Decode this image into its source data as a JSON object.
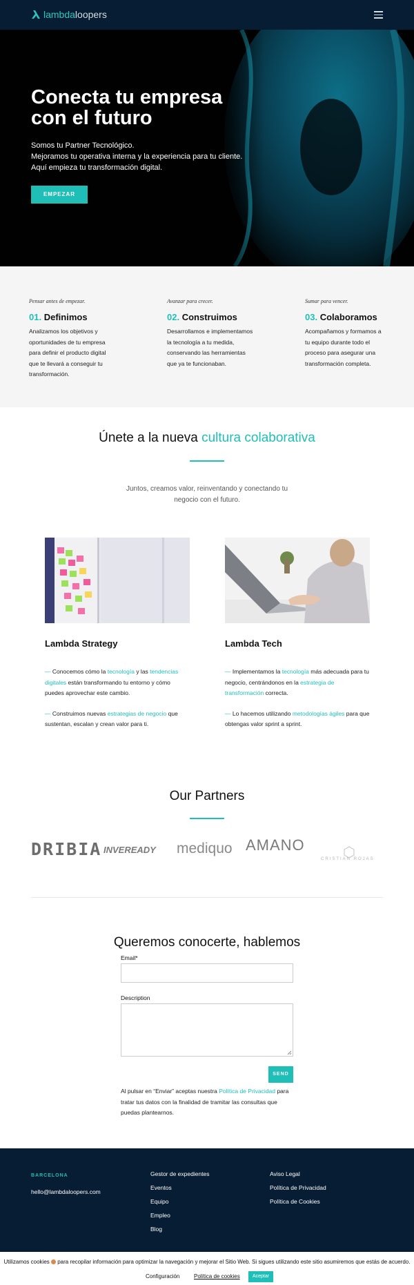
{
  "header": {
    "logo_bold": "lambda",
    "logo_rest": "loopers"
  },
  "hero": {
    "title_line1": "Conecta tu empresa",
    "title_line2": "con el futuro",
    "sub_line1": "Somos tu Partner Tecnológico.",
    "sub_line2": "Mejoramos tu operativa interna y la experiencia para tu cliente.",
    "sub_line3": "Aquí empieza tu transformación digital.",
    "cta": "EMPEZAR"
  },
  "steps": [
    {
      "kicker": "Pensar antes de empezar.",
      "num": "01.",
      "title": "Definimos",
      "text": "Analizamos los objetivos y oportunidades de tu empresa para definir el producto digital que te llevará a conseguir tu transformación."
    },
    {
      "kicker": "Avanzar para crecer.",
      "num": "02.",
      "title": "Construimos",
      "text": "Desarrollamos e implementamos la tecnología a tu medida, conservando las herramientas que ya te funcionaban."
    },
    {
      "kicker": "Sumar para vencer.",
      "num": "03.",
      "title": "Colaboramos",
      "text": "Acompañamos y formamos a tu equipo durante todo el proceso para asegurar una transformación completa."
    }
  ],
  "culture": {
    "title_plain": "Únete a la nueva",
    "title_accent": "cultura colaborativa",
    "lede": "Juntos, creamos valor, reinventando y conectando tu negocio con el futuro."
  },
  "cards": [
    {
      "title": "Lambda Strategy",
      "p1": [
        "— ",
        "Conocemos cómo la ",
        "tecnología",
        " y las ",
        "tendencias digitales",
        " están transformando tu entorno y cómo puedes aprovechar este cambio."
      ],
      "p2": [
        "— ",
        "Construimos nuevas ",
        "estrategias de negocio",
        " que sustentan, escalan y crean valor para ti."
      ]
    },
    {
      "title": "Lambda Tech",
      "p1": [
        "— ",
        "Implementamos la ",
        "tecnología",
        " más adecuada para tu negocio, centrándonos en la ",
        "estrategia de transformación",
        " correcta."
      ],
      "p2": [
        "— ",
        "Lo hacemos utilizando ",
        "metodologías ágiles",
        " para que obtengas valor sprint a sprint."
      ]
    }
  ],
  "partners": {
    "title": "Our Partners",
    "logos": [
      "DRIBIA",
      "INVEREADY",
      "mediquo",
      "AMANO",
      "CRISTIAN ROJAS"
    ]
  },
  "form": {
    "title": "Queremos conocerte, hablemos",
    "email_label": "Email*",
    "desc_label": "Description",
    "send": "SEND",
    "consent_pre": "Al pulsar en “Enviar” aceptas nuestra ",
    "consent_link": "Política de Privacidad",
    "consent_post": " para tratar tus datos con la finalidad de tramitar las consultas que puedas plantearnos."
  },
  "footer": {
    "city": "BARCELONA",
    "email": "hello@lambdaloopers.com",
    "col1": [
      "Gestor de expedientes",
      "Eventos",
      "Equipo",
      "Empleo",
      "Blog"
    ],
    "col2": [
      "Aviso Legal",
      "Política de Privacidad",
      "Política de Cookies"
    ]
  },
  "cookie": {
    "text_pre": "Utilizamos cookies ",
    "text_post": " para recopilar información para optimizar la navegación y mejorar el Sitio Web. Si sigues utilizando este sitio asumiremos que estás de acuerdo.",
    "config": "Configuración",
    "policy": "Política de cookies",
    "accept": "Aceptar"
  },
  "colors": {
    "accent": "#1fbfb8",
    "navy": "#061d33"
  }
}
